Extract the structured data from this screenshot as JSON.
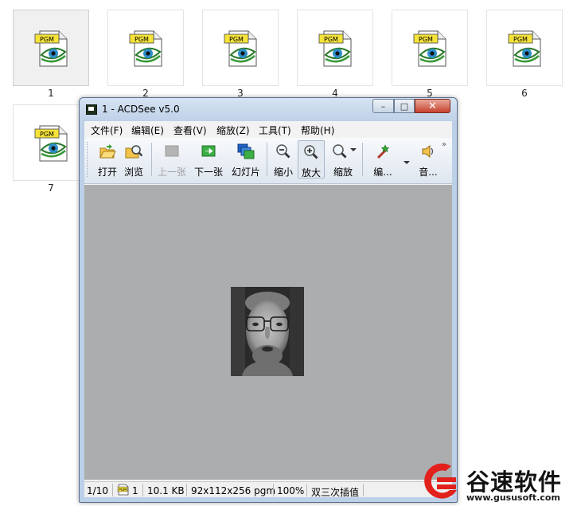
{
  "explorer": {
    "files": [
      {
        "label": "1",
        "type": "PGM",
        "selected": true
      },
      {
        "label": "2",
        "type": "PGM",
        "selected": false
      },
      {
        "label": "3",
        "type": "PGM",
        "selected": false
      },
      {
        "label": "4",
        "type": "PGM",
        "selected": false
      },
      {
        "label": "5",
        "type": "PGM",
        "selected": false
      },
      {
        "label": "6",
        "type": "PGM",
        "selected": false
      },
      {
        "label": "7",
        "type": "PGM",
        "selected": false
      }
    ],
    "file_icon": "pgm-eye-document-icon"
  },
  "window": {
    "title": "1 - ACDSee v5.0",
    "controls": {
      "minimize": "–",
      "maximize": "□",
      "close": "✕"
    }
  },
  "menu": [
    "文件(F)",
    "编辑(E)",
    "查看(V)",
    "缩放(Z)",
    "工具(T)",
    "帮助(H)"
  ],
  "toolbar": {
    "open": "打开",
    "browse": "浏览",
    "prev": "上一张",
    "next": "下一张",
    "slideshow": "幻灯片",
    "zoom_out": "缩小",
    "zoom_in": "放大",
    "zoom": "缩放",
    "edit": "编...",
    "audio": "音...",
    "more": "»"
  },
  "status": {
    "position": "1/10",
    "format_icon_text": "PGM",
    "index": "1",
    "size": "10.1 KB",
    "dimensions": "92x112x256 pgm",
    "zoom": "100%",
    "interpolation": "双三次插值"
  },
  "watermark": {
    "name": "谷速软件",
    "url": "www.gususoft.com"
  },
  "colors": {
    "viewer_bg": "#abadae",
    "title_bg": "#c9d9ec",
    "close_button": "#c7412f",
    "watermark_red": "#e2211c"
  }
}
